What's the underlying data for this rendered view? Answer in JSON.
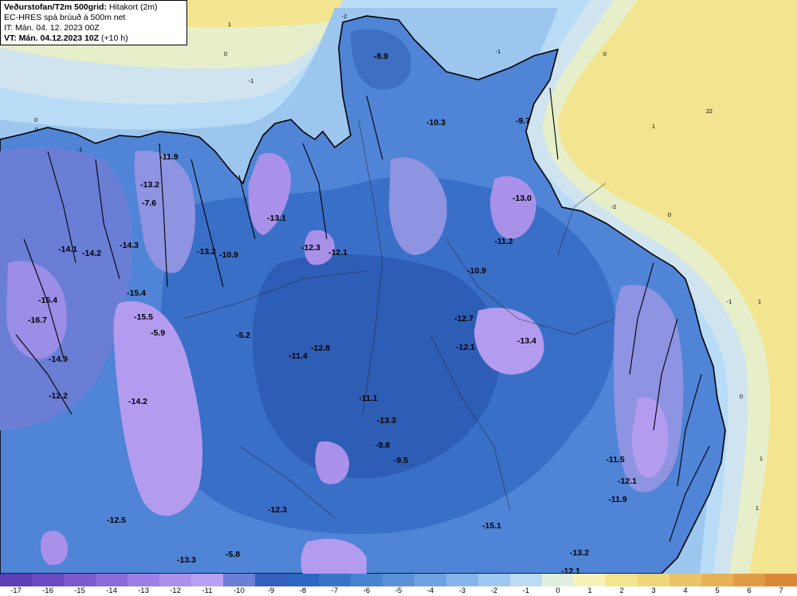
{
  "header": {
    "title": "Veðurstofan/T2m 500grid:",
    "subtitle": "Hitakort (2m)",
    "model": "EC-HRES spá brúuð á 500m net",
    "init_time": "IT: Mán. 04. 12. 2023 00Z",
    "valid_time": "VT: Mán. 04.12.2023 10Z",
    "lead": "(+10 h)"
  },
  "colors": {
    "sea_warm": "#f3e58f",
    "sea_pale": "#e6efc9",
    "sea_blue": "#b8dcf6",
    "land_0": "#8db8ec",
    "land_m4": "#5b8fdc",
    "land_m7": "#3a6fc8",
    "land_m9": "#2d5db5",
    "land_m11": "#5470cc",
    "land_m13": "#9a8ee6",
    "land_m15": "#b39cf0",
    "coast": "#000000"
  },
  "scale": {
    "labels": [
      "-17",
      "-16",
      "-15",
      "-14",
      "-13",
      "-12",
      "-11",
      "-10",
      "-9",
      "-8",
      "-7",
      "-6",
      "-5",
      "-4",
      "-3",
      "-2",
      "-1",
      "0",
      "1",
      "2",
      "3",
      "4",
      "5",
      "6",
      "7"
    ],
    "colors": [
      "#5a3fb5",
      "#6a4cc4",
      "#7c5bd0",
      "#8c6cdb",
      "#9a80e4",
      "#a991ea",
      "#b6a2ef",
      "#6d7fd4",
      "#355fbf",
      "#2f66c4",
      "#3a72ca",
      "#4a82d2",
      "#5b91d9",
      "#6ea2e2",
      "#86b5ea",
      "#9fc8f1",
      "#bcdcf5",
      "#e0efe0",
      "#f7f3b8",
      "#f3e58f",
      "#eed77a",
      "#e9c567",
      "#e5b256",
      "#e09c45",
      "#d98839"
    ]
  },
  "map": {
    "region": "Iceland",
    "max_labels": [
      {
        "value": "-8.9"
      },
      {
        "value": "-10.3"
      },
      {
        "value": "-9.7"
      },
      {
        "value": "-11.9"
      },
      {
        "value": "-13.2"
      },
      {
        "value": "-7.6"
      },
      {
        "value": "-13.1"
      },
      {
        "value": "-13.0"
      },
      {
        "value": "-11.2"
      },
      {
        "value": "-14.3"
      },
      {
        "value": "-14.1"
      },
      {
        "value": "-14.2"
      },
      {
        "value": "-13.2"
      },
      {
        "value": "-10.9"
      },
      {
        "value": "-12.3"
      },
      {
        "value": "-12.1"
      },
      {
        "value": "-10.9"
      },
      {
        "value": "-15.4"
      },
      {
        "value": "-15.4"
      },
      {
        "value": "-16.7"
      },
      {
        "value": "-15.5"
      },
      {
        "value": "-12.7"
      },
      {
        "value": "-5.9"
      },
      {
        "value": "-5.2"
      },
      {
        "value": "-12.1"
      },
      {
        "value": "-13.4"
      },
      {
        "value": "-11.4"
      },
      {
        "value": "-12.8"
      },
      {
        "value": "-14.9"
      },
      {
        "value": "-12.2"
      },
      {
        "value": "-14.2"
      },
      {
        "value": "-11.1"
      },
      {
        "value": "-13.3"
      },
      {
        "value": "-9.8"
      },
      {
        "value": "-9.5"
      },
      {
        "value": "-11.5"
      },
      {
        "value": "-12.1"
      },
      {
        "value": "-11.9"
      },
      {
        "value": "-12.5"
      },
      {
        "value": "-12.3"
      },
      {
        "value": "-15.1"
      },
      {
        "value": "-13.3"
      },
      {
        "value": "-5.8"
      },
      {
        "value": "-13.2"
      },
      {
        "value": "-12.1"
      }
    ],
    "isoline_labels": [
      {
        "value": "2"
      },
      {
        "value": "1"
      },
      {
        "value": "0"
      },
      {
        "value": "-1"
      },
      {
        "value": "-2"
      },
      {
        "value": "0"
      },
      {
        "value": "1"
      },
      {
        "value": "2"
      },
      {
        "value": "-1"
      },
      {
        "value": "0"
      },
      {
        "value": "1"
      },
      {
        "value": "0"
      },
      {
        "value": "1"
      },
      {
        "value": "-1"
      },
      {
        "value": "-2"
      },
      {
        "value": "0"
      },
      {
        "value": "-1"
      },
      {
        "value": "1"
      },
      {
        "value": "0"
      }
    ]
  }
}
